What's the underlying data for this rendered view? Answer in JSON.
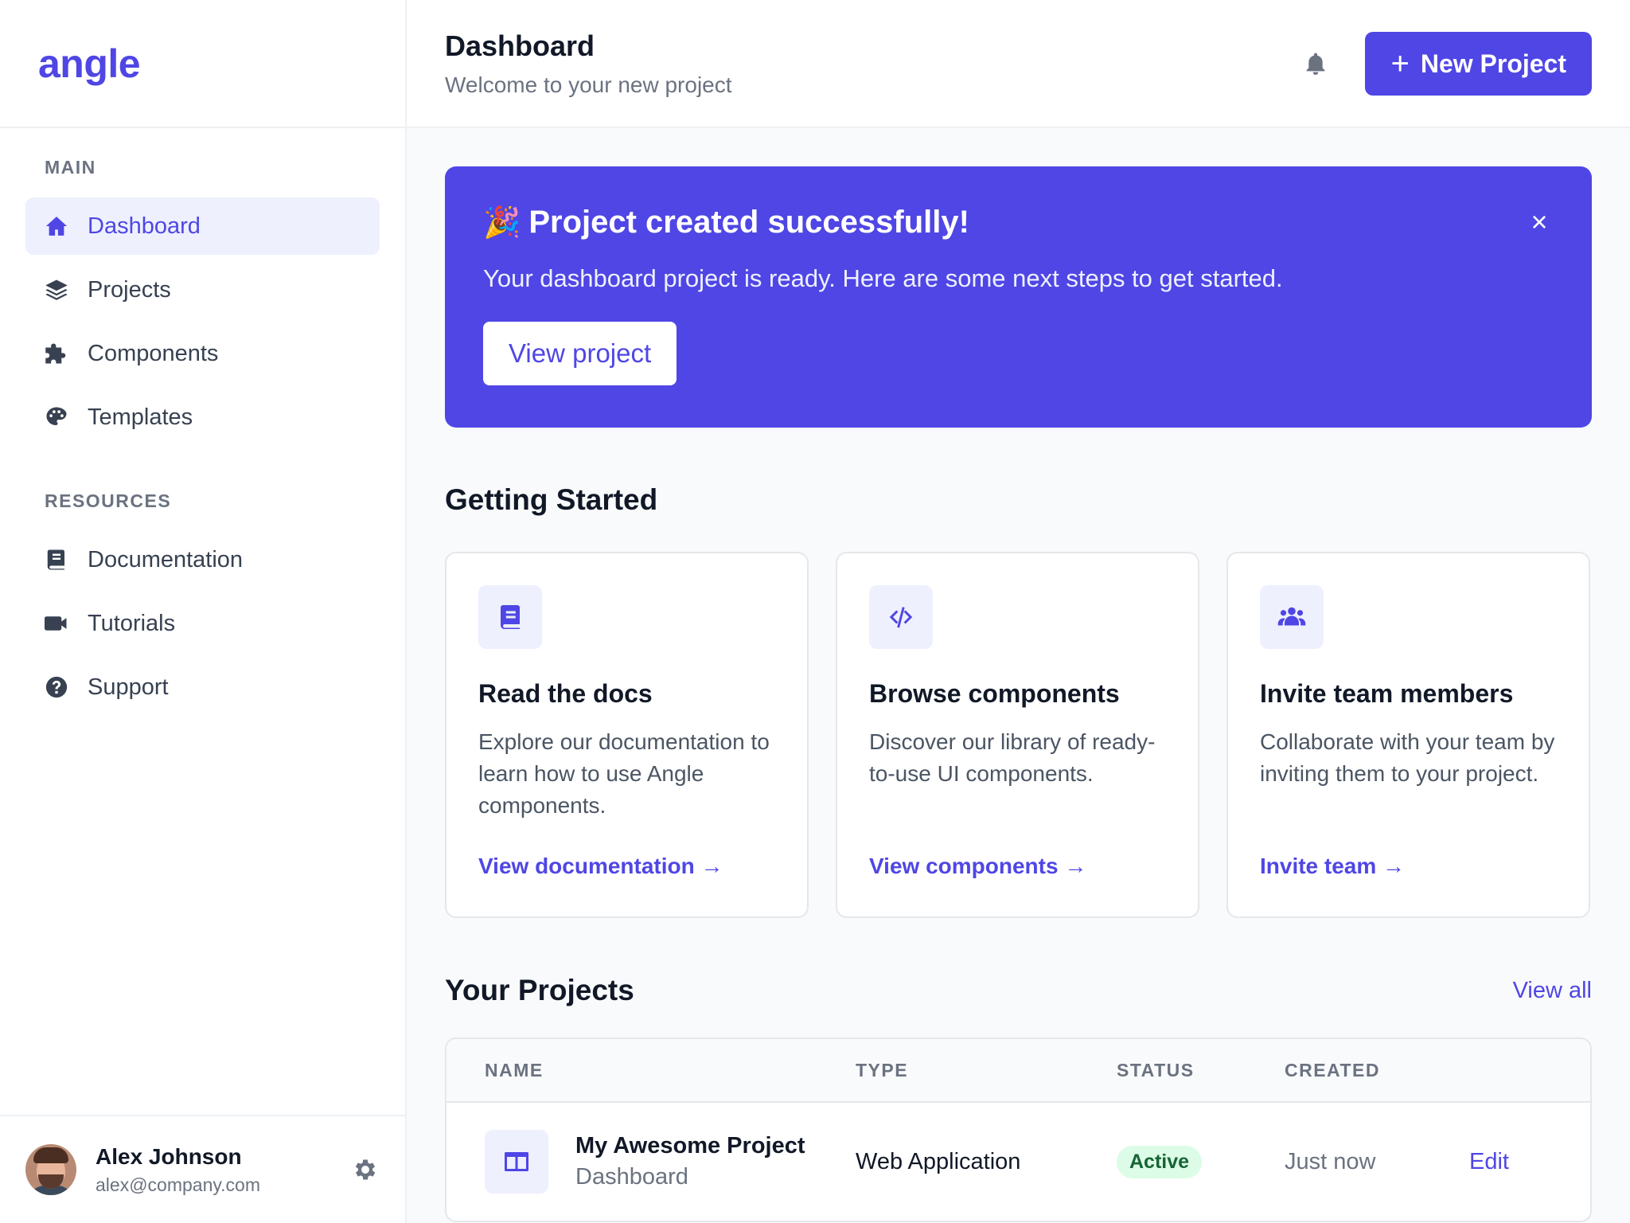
{
  "sidebar": {
    "brand": "angle",
    "sections": [
      {
        "heading": "MAIN",
        "items": [
          {
            "label": "Dashboard",
            "icon": "home-icon",
            "active": true
          },
          {
            "label": "Projects",
            "icon": "layers-icon"
          },
          {
            "label": "Components",
            "icon": "puzzle-icon"
          },
          {
            "label": "Templates",
            "icon": "palette-icon"
          }
        ]
      },
      {
        "heading": "RESOURCES",
        "items": [
          {
            "label": "Documentation",
            "icon": "book-icon"
          },
          {
            "label": "Tutorials",
            "icon": "video-icon"
          },
          {
            "label": "Support",
            "icon": "question-icon"
          }
        ]
      }
    ],
    "user": {
      "name": "Alex Johnson",
      "email": "alex@company.com"
    }
  },
  "header": {
    "title": "Dashboard",
    "subtitle": "Welcome to your new project",
    "new_project_label": "New Project"
  },
  "banner": {
    "emoji": "🎉",
    "title": "Project created successfully!",
    "text": "Your dashboard project is ready. Here are some next steps to get started.",
    "button": "View project",
    "close": "×"
  },
  "getting_started": {
    "title": "Getting Started",
    "cards": [
      {
        "icon": "book-icon",
        "title": "Read the docs",
        "desc": "Explore our documentation to learn how to use Angle components.",
        "link": "View documentation →"
      },
      {
        "icon": "code-icon",
        "title": "Browse components",
        "desc": "Discover our library of ready-to-use UI components.",
        "link": "View components →"
      },
      {
        "icon": "users-icon",
        "title": "Invite team members",
        "desc": "Collaborate with your team by inviting them to your project.",
        "link": "Invite team →"
      }
    ]
  },
  "projects": {
    "title": "Your Projects",
    "view_all": "View all",
    "columns": [
      "NAME",
      "TYPE",
      "STATUS",
      "CREATED"
    ],
    "rows": [
      {
        "name": "My Awesome Project",
        "subtitle": "Dashboard",
        "type": "Web Application",
        "status": "Active",
        "created": "Just now",
        "action": "Edit"
      }
    ]
  },
  "colors": {
    "accent": "#4f46e5",
    "status_active_bg": "#dcfce7",
    "status_active_text": "#166534"
  }
}
